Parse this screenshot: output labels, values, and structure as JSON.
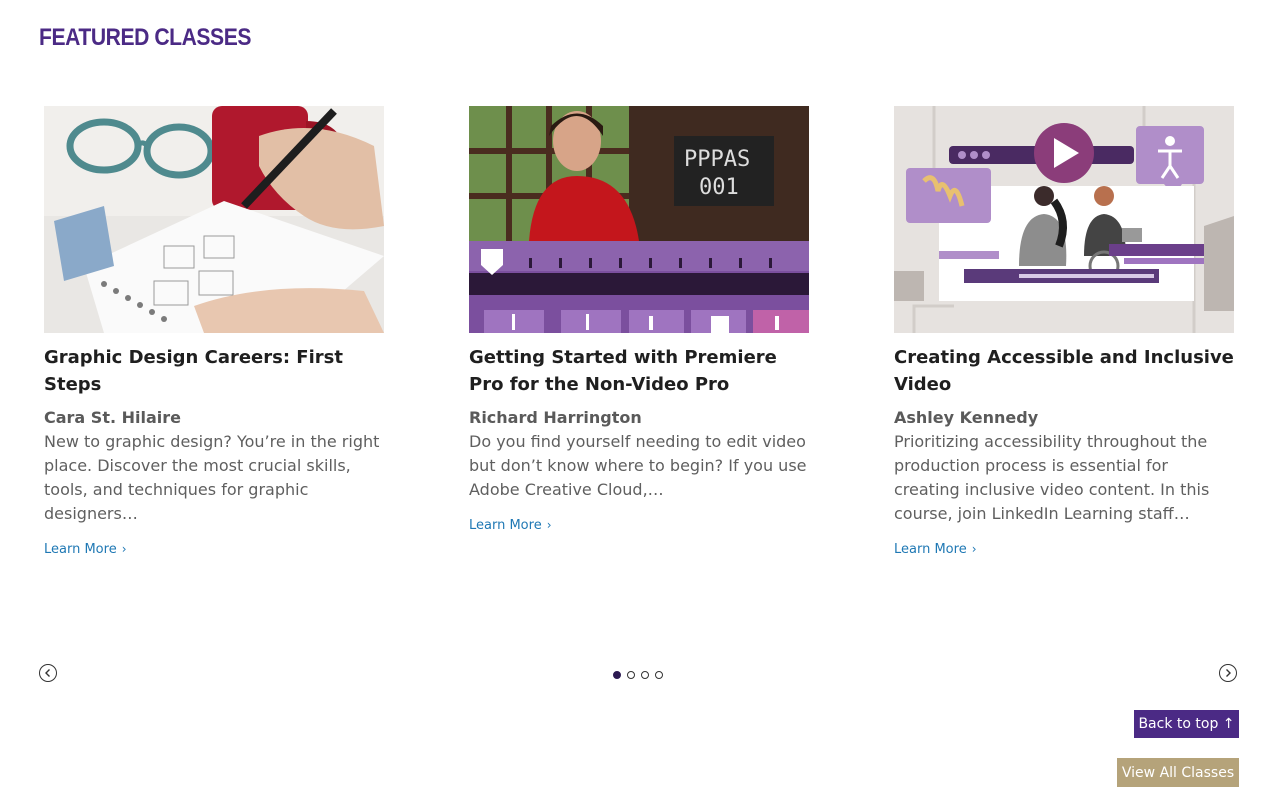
{
  "section": {
    "title": "FEATURED CLASSES"
  },
  "cards": [
    {
      "title": "Graphic Design Careers: First Steps",
      "author": "Cara St. Hilaire",
      "description": "New to graphic design? You’re in the right place. Discover the most crucial skills, tools, and techniques for graphic designers…",
      "link": "Learn More"
    },
    {
      "title": "Getting Started with Premiere Pro for the Non-Video Pro",
      "author": "Richard Harrington",
      "description": "Do you find yourself needing to edit video but don’t know where to begin? If you use Adobe Creative Cloud,…",
      "link": "Learn More"
    },
    {
      "title": "Creating Accessible and Inclusive Video",
      "author": "Ashley Kennedy",
      "description": "Prioritizing accessibility throughout the production process is essential for creating inclusive video content. In this course, join LinkedIn Learning staff…",
      "link": "Learn More"
    }
  ],
  "carousel": {
    "active_index": 0,
    "dot_count": 4
  },
  "buttons": {
    "back_to_top": "Back to top ↑",
    "view_all": "View All Classes"
  },
  "colors": {
    "brand_purple": "#4b2a85",
    "gold": "#b5a37a",
    "link_blue": "#1f78b4"
  },
  "icons": {
    "prev": "chevron-left-icon",
    "next": "chevron-right-icon",
    "link": "chevron-right-icon"
  }
}
